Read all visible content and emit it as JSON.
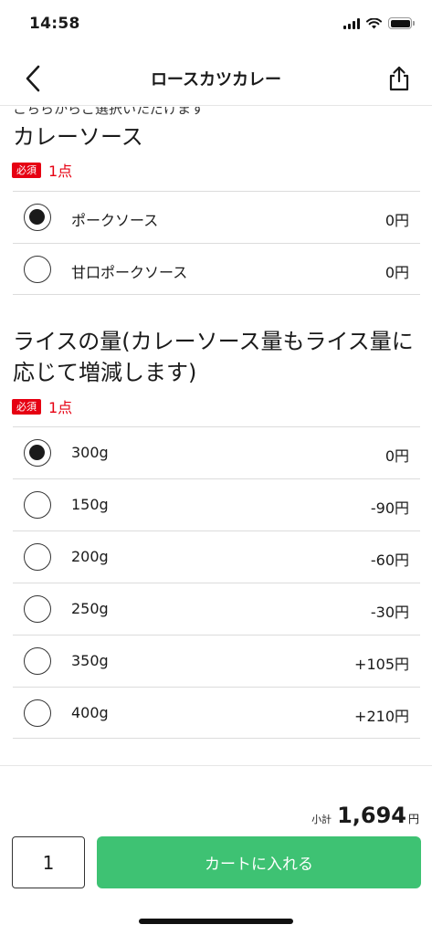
{
  "status": {
    "time": "14:58"
  },
  "nav": {
    "title": "ロースカツカレー"
  },
  "cut_text": "こちらからご選択いただけます",
  "sections": [
    {
      "title": "カレーソース",
      "required_badge": "必須",
      "required_count": "1点",
      "options": [
        {
          "label": "ポークソース",
          "price": "0円",
          "selected": true
        },
        {
          "label": "甘口ポークソース",
          "price": "0円",
          "selected": false
        }
      ]
    },
    {
      "title": "ライスの量(カレーソース量もライス量に応じて増減します)",
      "required_badge": "必須",
      "required_count": "1点",
      "options": [
        {
          "label": "300g",
          "price": "0円",
          "selected": true
        },
        {
          "label": "150g",
          "price": "-90円",
          "selected": false
        },
        {
          "label": "200g",
          "price": "-60円",
          "selected": false
        },
        {
          "label": "250g",
          "price": "-30円",
          "selected": false
        },
        {
          "label": "350g",
          "price": "+105円",
          "selected": false
        },
        {
          "label": "400g",
          "price": "+210円",
          "selected": false
        }
      ]
    }
  ],
  "footer": {
    "subtotal_label": "小計",
    "subtotal_value": "1,694",
    "subtotal_unit": "円",
    "quantity": "1",
    "cart_button_label": "カートに入れる"
  },
  "colors": {
    "accent": "#3ec273",
    "required": "#e60012"
  },
  "icons": {
    "back": "chevron-left-icon",
    "share": "share-icon"
  }
}
